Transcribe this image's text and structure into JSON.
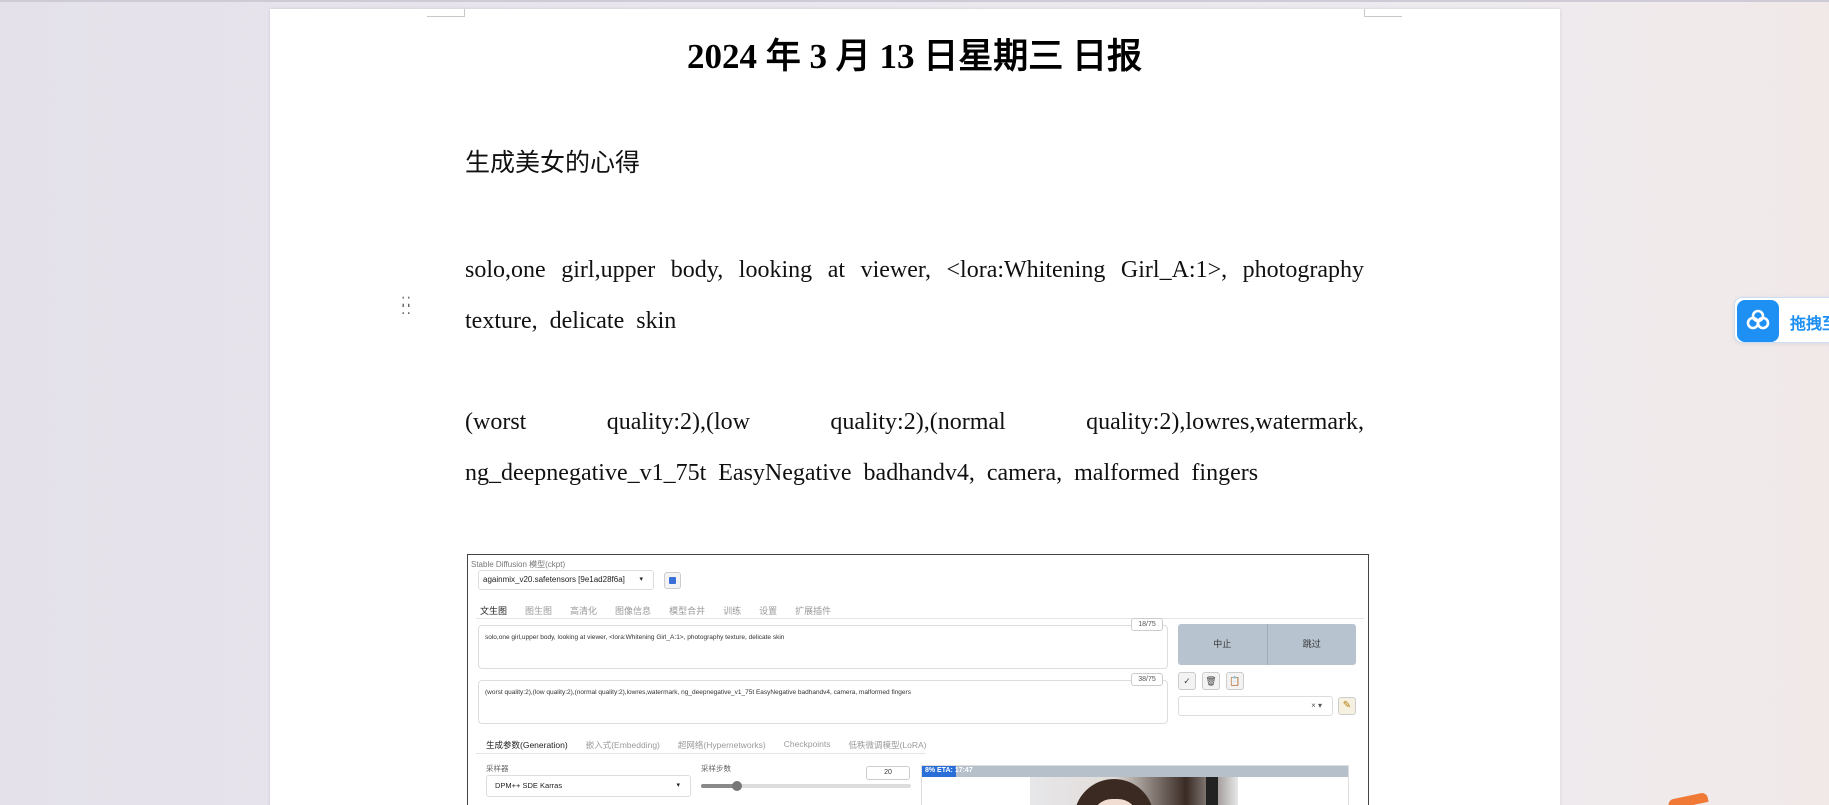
{
  "document": {
    "title": "2024 年 3 月 13 日星期三  日报",
    "heading": "生成美女的心得",
    "paragraphs": [
      "solo,one girl,upper body, looking at viewer, <lora:Whitening Girl_A:1>, photography texture, delicate skin",
      "(worst quality:2),(low quality:2),(normal quality:2),lowres,watermark, ng_deepnegative_v1_75t EasyNegative badhandv4, camera, malformed fingers"
    ]
  },
  "embedded_screenshot": {
    "model_label": "Stable Diffusion 模型(ckpt)",
    "model_value": "againmix_v20.safetensors [9e1ad28f6a]",
    "tabs": [
      "文生图",
      "图生图",
      "高清化",
      "图像信息",
      "模型合并",
      "训练",
      "设置",
      "扩展插件"
    ],
    "positive_prompt": "solo,one girl,upper body, looking at viewer, <lora:Whitening Girl_A:1>, photography texture, delicate skin",
    "positive_counter": "18/75",
    "negative_prompt": "(worst quality:2),(low quality:2),(normal quality:2),lowres,watermark, ng_deepnegative_v1_75t EasyNegative badhandv4, camera, malformed fingers",
    "negative_counter": "38/75",
    "interrupt_label": "中止",
    "skip_label": "跳过",
    "tool_icons": [
      "check-icon",
      "trash-icon",
      "clipboard-icon"
    ],
    "style_clear": "× ▾",
    "sub_tabs": [
      "生成参数(Generation)",
      "嵌入式(Embedding)",
      "超网络(Hypernetworks)",
      "Checkpoints",
      "低秩微调模型(LoRA)"
    ],
    "sampler_label": "采样器",
    "sampler_value": "DPM++ SDE Karras",
    "steps_label": "采样步数",
    "steps_value": "20",
    "progress_text": "8% ETA: 17:47",
    "progress_fraction": 0.08,
    "steps_fraction": 0.17
  },
  "assistant": {
    "label": "拖拽至"
  },
  "colors": {
    "accent_blue": "#1e8ff3",
    "progress_blue": "#2a6fd8",
    "button_gray": "#b7c3cf"
  }
}
